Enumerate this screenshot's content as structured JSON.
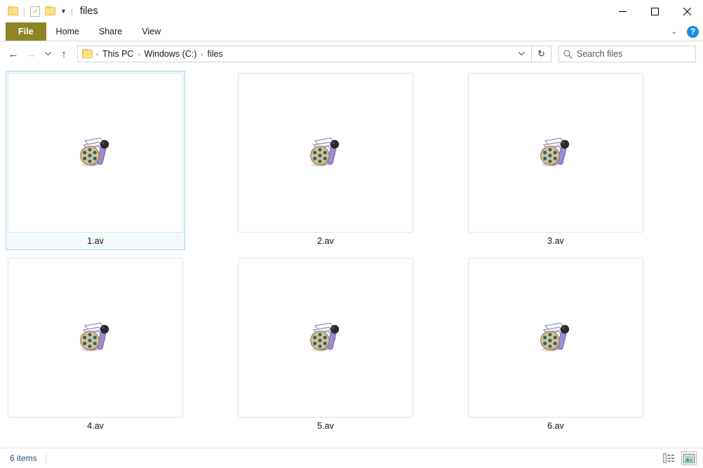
{
  "window": {
    "title": "files",
    "quick_access": [
      {
        "icon": "folder-icon",
        "name": "properties-folder-icon"
      },
      {
        "icon": "document-check-icon",
        "name": "quick-access-doc-icon"
      },
      {
        "icon": "folder-icon",
        "name": "new-folder-icon"
      }
    ],
    "controls": {
      "minimize": "─",
      "maximize": "☐",
      "close": "✕"
    }
  },
  "ribbon": {
    "tabs": [
      {
        "label": "File",
        "active_file": true
      },
      {
        "label": "Home",
        "active_file": false
      },
      {
        "label": "Share",
        "active_file": false
      },
      {
        "label": "View",
        "active_file": false
      }
    ],
    "expand_icon": "⌄",
    "help_label": "?",
    "file_tab_color": "#8e8526"
  },
  "addressbar": {
    "back_icon": "←",
    "forward_icon": "→",
    "recent_icon": "⌄",
    "up_icon": "↑",
    "breadcrumb": [
      "This PC",
      "Windows (C:)",
      "files"
    ],
    "breadcrumb_separator": "›",
    "dropdown_icon": "⌄",
    "refresh_icon": "↻"
  },
  "search": {
    "placeholder": "Search files",
    "icon": "search-icon"
  },
  "files": [
    {
      "name": "1.av",
      "selected": true,
      "icon": "media-file-icon"
    },
    {
      "name": "2.av",
      "selected": false,
      "icon": "media-file-icon"
    },
    {
      "name": "3.av",
      "selected": false,
      "icon": "media-file-icon"
    },
    {
      "name": "4.av",
      "selected": false,
      "icon": "media-file-icon"
    },
    {
      "name": "5.av",
      "selected": false,
      "icon": "media-file-icon"
    },
    {
      "name": "6.av",
      "selected": false,
      "icon": "media-file-icon"
    }
  ],
  "statusbar": {
    "items_text": "6 items",
    "views": [
      {
        "name": "details-view",
        "active": false
      },
      {
        "name": "large-icons-view",
        "active": true
      }
    ]
  },
  "colors": {
    "selection_border": "#a5d6f0",
    "selection_fill": "#f2fafd",
    "status_text": "#1b4f82",
    "help_blue": "#1b8fe0"
  }
}
